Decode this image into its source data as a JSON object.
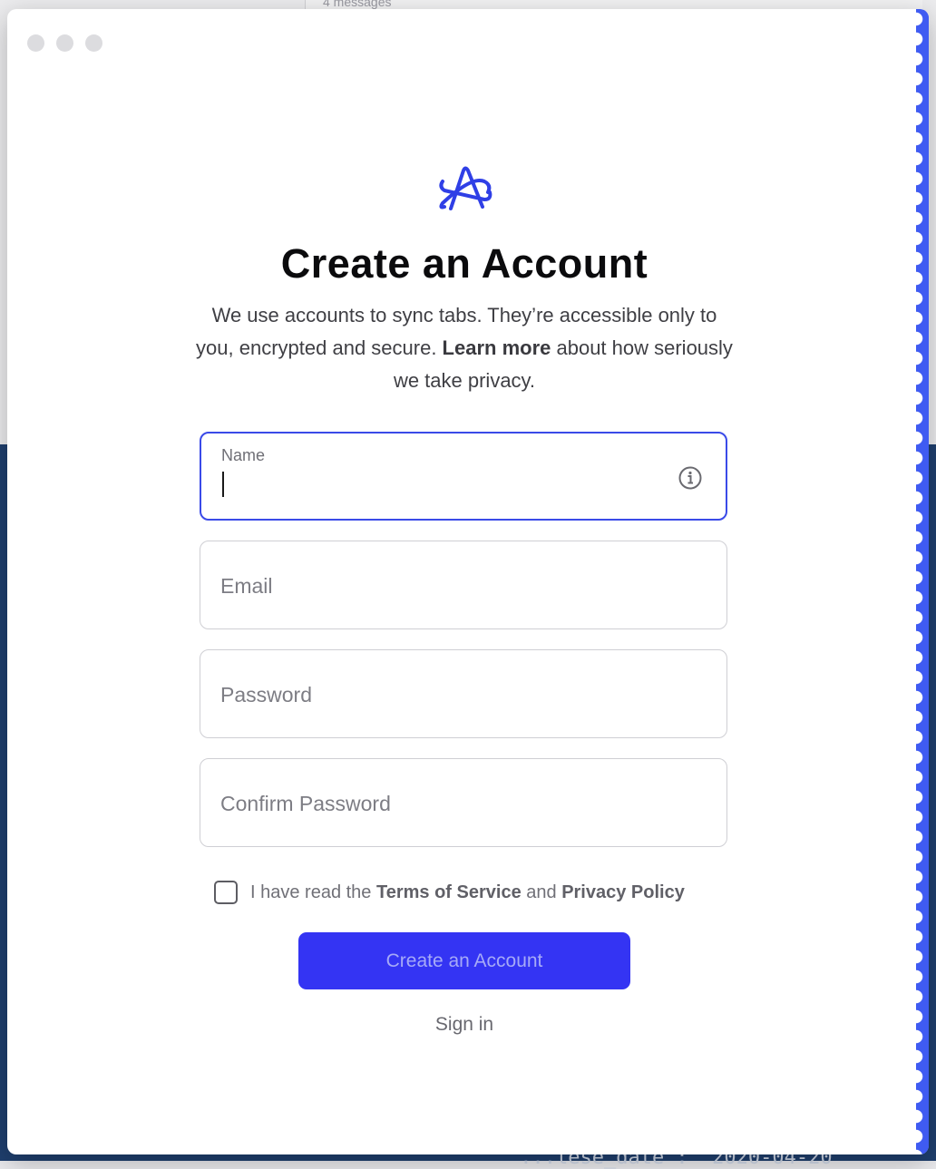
{
  "background": {
    "top_text": "4 messages",
    "bottom_text": "\"...lese_date\": \"2020-04-20"
  },
  "dialog": {
    "title": "Create an Account",
    "description_part1": "We use accounts to sync tabs. They’re accessible only to you, encrypted and secure. ",
    "learn_more": "Learn more",
    "description_part2": " about how seriously we take privacy.",
    "fields": {
      "name_label": "Name",
      "email_placeholder": "Email",
      "password_placeholder": "Password",
      "confirm_placeholder": "Confirm Password"
    },
    "terms": {
      "prefix": "I have read the ",
      "tos": "Terms of Service",
      "and": " and ",
      "privacy": "Privacy Policy"
    },
    "create_button": "Create an Account",
    "signin_link": "Sign in"
  },
  "colors": {
    "accent": "#3434f3",
    "focus_border": "#3a4ae8",
    "logo": "#2f3fe6"
  },
  "icons": [
    "arc-logo-icon",
    "info-icon"
  ]
}
